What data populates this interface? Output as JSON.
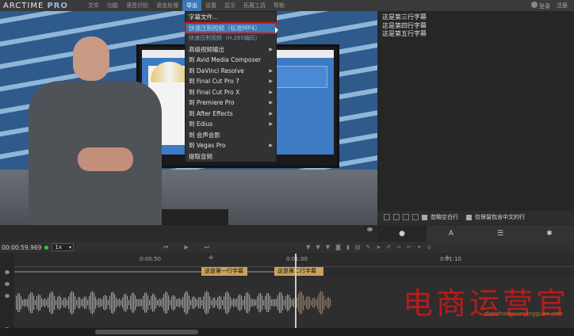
{
  "menubar": {
    "logo_text": "ARCTIME",
    "logo_pro": "PRO",
    "items": [
      "文件",
      "功能",
      "语音识别",
      "语言处理",
      "导出",
      "设置",
      "显示",
      "拓展工具",
      "帮助"
    ],
    "active_index": 4,
    "login": "登录",
    "register": "注册"
  },
  "export_menu": {
    "items": [
      {
        "label": "字幕文件...",
        "arrow": false,
        "style": "normal"
      },
      {
        "label": "快速压制视频（标准MP4）",
        "arrow": false,
        "style": "highlight"
      },
      {
        "label": "快速压制视频（H.265编码）",
        "arrow": false,
        "style": "muted"
      },
      {
        "label": "高级视频输出",
        "arrow": true,
        "style": "normal"
      },
      {
        "label": "到 Avid Media Composer",
        "arrow": false,
        "style": "normal"
      },
      {
        "label": "到 DaVinci Resolve",
        "arrow": true,
        "style": "normal"
      },
      {
        "label": "到 Final Cut Pro 7",
        "arrow": true,
        "style": "normal"
      },
      {
        "label": "到 Final Cut Pro X",
        "arrow": true,
        "style": "normal"
      },
      {
        "label": "到 Premiere Pro",
        "arrow": true,
        "style": "normal"
      },
      {
        "label": "到 After Effects",
        "arrow": true,
        "style": "normal"
      },
      {
        "label": "到 Edius",
        "arrow": true,
        "style": "normal"
      },
      {
        "label": "到 会声会影",
        "arrow": false,
        "style": "normal"
      },
      {
        "label": "到 Vegas Pro",
        "arrow": true,
        "style": "normal"
      },
      {
        "label": "提取音频",
        "arrow": false,
        "style": "normal"
      }
    ]
  },
  "subtitle_list": [
    "这是第三行字幕",
    "这是第四行字幕",
    "这是第五行字幕"
  ],
  "right_toolbar": {
    "skip_empty_label": "忽略空白行",
    "keep_chinese_label": "仅保留包含中文的行"
  },
  "right_tabs": [
    "chat-icon",
    "font-icon",
    "list-icon",
    "settings-icon"
  ],
  "timeline": {
    "timecode": "00:00:59.969",
    "speed": "1x",
    "ruler_labels": [
      "0:00:50",
      "0:01:00",
      "0:01:10"
    ],
    "subtitle_blocks": [
      "这是第一行字幕",
      "这是第二行字幕"
    ]
  },
  "watermark": {
    "main": "电商运营官",
    "sub": "dianshangyunyingguan.com"
  },
  "colors": {
    "accent": "#3c78b5",
    "highlight_border": "#dd1111",
    "subtitle_block": "#caa25a",
    "watermark": "#c41a1a"
  }
}
